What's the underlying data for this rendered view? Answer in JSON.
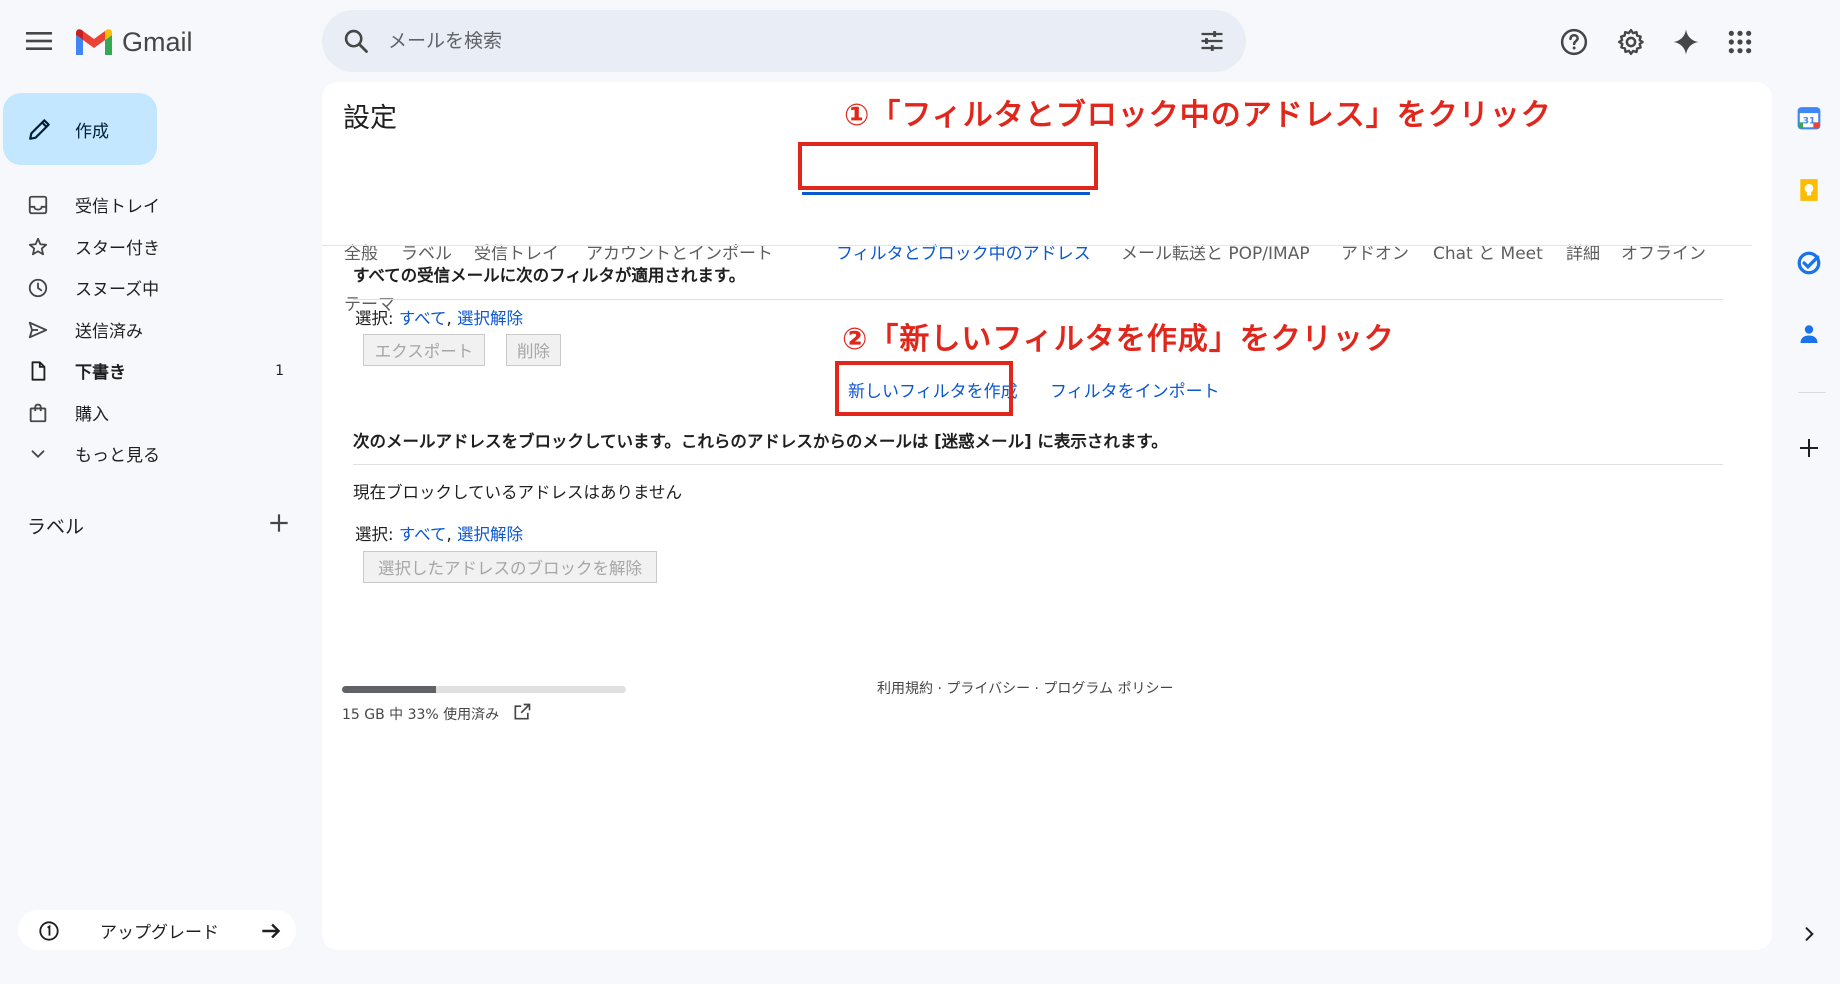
{
  "app": {
    "name": "Gmail"
  },
  "search": {
    "placeholder": "メールを検索"
  },
  "compose": {
    "label": "作成"
  },
  "nav": {
    "items": [
      {
        "label": "受信トレイ",
        "icon": "inbox-icon"
      },
      {
        "label": "スター付き",
        "icon": "star-icon"
      },
      {
        "label": "スヌーズ中",
        "icon": "clock-icon"
      },
      {
        "label": "送信済み",
        "icon": "send-icon"
      },
      {
        "label": "下書き",
        "icon": "draft-icon",
        "count": "1"
      },
      {
        "label": "購入",
        "icon": "shopping-bag-icon"
      },
      {
        "label": "もっと見る",
        "icon": "chevron-down-icon"
      }
    ],
    "labels_heading": "ラベル"
  },
  "upgrade": {
    "label": "アップグレード"
  },
  "settings": {
    "title": "設定",
    "tabs": [
      {
        "label": "全般"
      },
      {
        "label": "ラベル"
      },
      {
        "label": "受信トレイ"
      },
      {
        "label": "アカウントとインポート"
      },
      {
        "label": "フィルタとブロック中のアドレス",
        "active": true
      },
      {
        "label": "メール転送と POP/IMAP"
      },
      {
        "label": "アドオン"
      },
      {
        "label": "Chat と Meet"
      },
      {
        "label": "詳細"
      },
      {
        "label": "オフライン"
      },
      {
        "label": "テーマ"
      }
    ],
    "filters": {
      "heading": "すべての受信メールに次のフィルタが適用されます。",
      "select_prefix": "選択: ",
      "select_all": "すべて",
      "comma": ", ",
      "select_none": "選択解除",
      "export_btn": "エクスポート",
      "delete_btn": "削除",
      "create_link": "新しいフィルタを作成",
      "import_link": "フィルタをインポート"
    },
    "blocked": {
      "heading": "次のメールアドレスをブロックしています。これらのアドレスからのメールは [迷惑メール] に表示されます。",
      "empty": "現在ブロックしているアドレスはありません",
      "select_prefix": "選択: ",
      "select_all": "すべて",
      "comma": ", ",
      "select_none": "選択解除",
      "unblock_btn": "選択したアドレスのブロックを解除"
    }
  },
  "annotations": {
    "step1": "①「フィルタとブロック中のアドレス」をクリック",
    "step2": "②「新しいフィルタを作成」をクリック",
    "color": "#e1261c"
  },
  "footer": {
    "storage": "15 GB 中 33% 使用済み",
    "storage_percent": 33,
    "links": "利用規約 · プライバシー · プログラム ポリシー"
  },
  "colors": {
    "accent": "#0b57d0",
    "compose_bg": "#c2e7ff",
    "page_bg": "#f6f8fc"
  }
}
